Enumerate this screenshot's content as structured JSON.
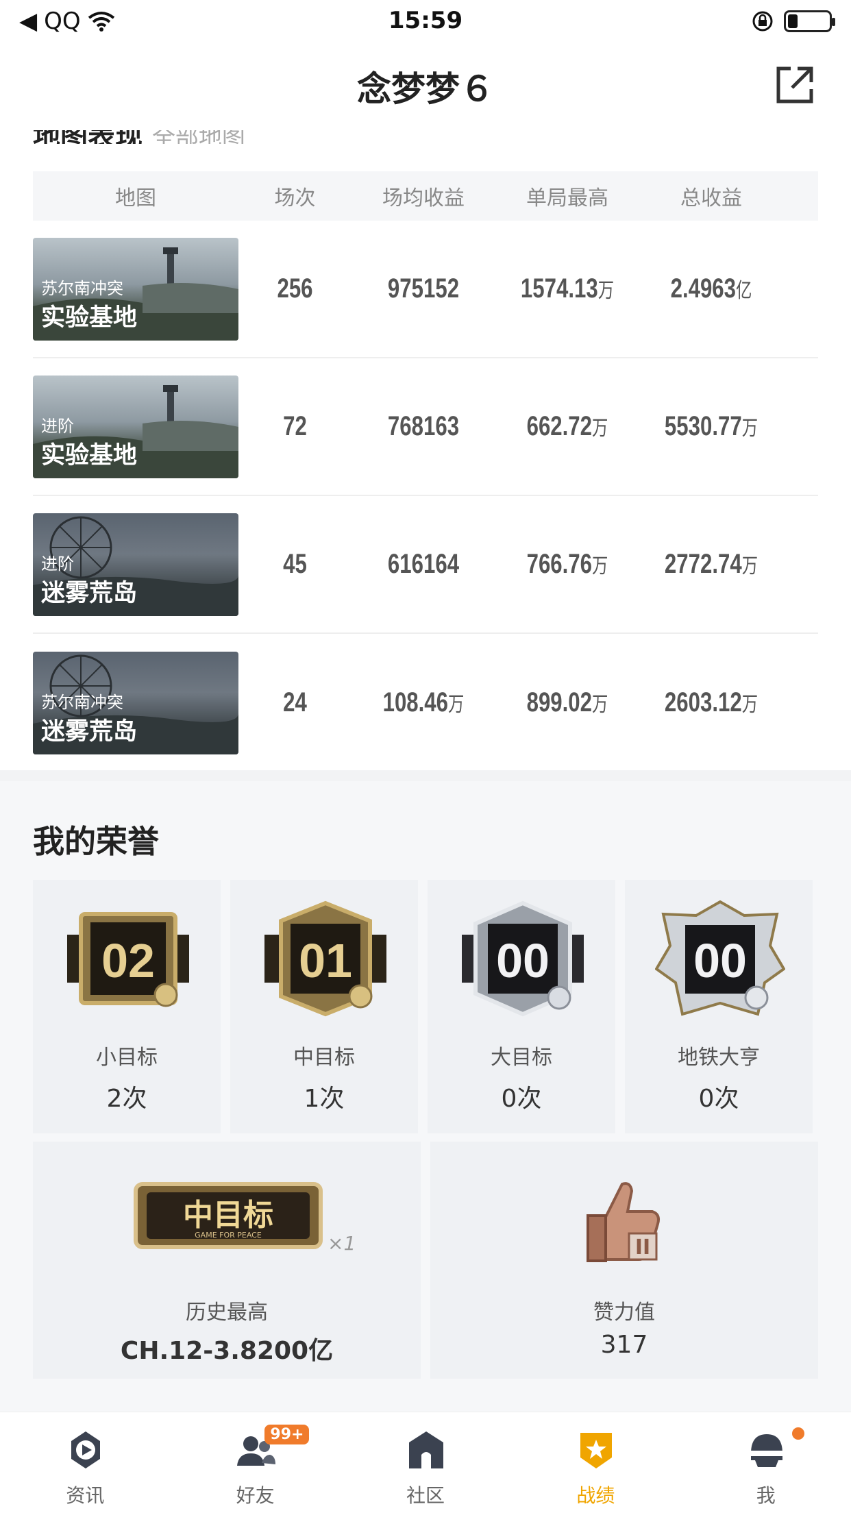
{
  "status_bar": {
    "back_app": "QQ",
    "time": "15:59"
  },
  "header": {
    "title": "念梦梦６"
  },
  "map_section": {
    "title": "地图表现",
    "all_link": "全部地图",
    "columns": [
      "地图",
      "场次",
      "场均收益",
      "单局最高",
      "总收益"
    ],
    "rows": [
      {
        "mode": "苏尔南冲突",
        "map": "实验基地",
        "matches": "256",
        "avg": "975152",
        "avg_unit": "",
        "best": "1574.13",
        "best_unit": "万",
        "total": "2.4963",
        "total_unit": "亿"
      },
      {
        "mode": "进阶",
        "map": "实验基地",
        "matches": "72",
        "avg": "768163",
        "avg_unit": "",
        "best": "662.72",
        "best_unit": "万",
        "total": "5530.77",
        "total_unit": "万"
      },
      {
        "mode": "进阶",
        "map": "迷雾荒岛",
        "matches": "45",
        "avg": "616164",
        "avg_unit": "",
        "best": "766.76",
        "best_unit": "万",
        "total": "2772.74",
        "total_unit": "万"
      },
      {
        "mode": "苏尔南冲突",
        "map": "迷雾荒岛",
        "matches": "24",
        "avg": "108.46",
        "avg_unit": "万",
        "best": "899.02",
        "best_unit": "万",
        "total": "2603.12",
        "total_unit": "万"
      }
    ]
  },
  "honor": {
    "title": "我的荣誉",
    "items": [
      {
        "badge_number": "02",
        "label": "小目标",
        "count": "2次",
        "tier": "gold"
      },
      {
        "badge_number": "01",
        "label": "中目标",
        "count": "1次",
        "tier": "gold"
      },
      {
        "badge_number": "00",
        "label": "大目标",
        "count": "0次",
        "tier": "silver"
      },
      {
        "badge_number": "00",
        "label": "地铁大亨",
        "count": "0次",
        "tier": "diamond"
      }
    ],
    "history": {
      "plaque_text": "中目标",
      "plaque_sub": "GAME FOR PEACE",
      "multiplier": "×1",
      "label": "历史最高",
      "value": "CH.12-3.8200亿"
    },
    "likes": {
      "label": "赞力值",
      "value": "317"
    }
  },
  "tabbar": {
    "tabs": [
      {
        "label": "资讯",
        "icon": "news-icon"
      },
      {
        "label": "好友",
        "icon": "friends-icon",
        "badge": "99+"
      },
      {
        "label": "社区",
        "icon": "community-icon"
      },
      {
        "label": "战绩",
        "icon": "record-icon",
        "active": true
      },
      {
        "label": "我",
        "icon": "profile-icon"
      }
    ]
  },
  "colors": {
    "accent": "#f0a500",
    "badge": "#f07b2b"
  }
}
